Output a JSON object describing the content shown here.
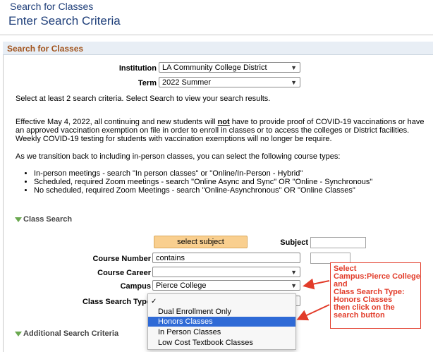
{
  "header": {
    "breadcrumb": "Search for Classes",
    "title": "Enter Search Criteria"
  },
  "panel": {
    "title": "Search for Classes"
  },
  "form": {
    "institution_label": "Institution",
    "institution_value": "LA Community College District",
    "term_label": "Term",
    "term_value": "2022 Summer"
  },
  "instructions": "Select at least 2 search criteria. Select Search to view your search results.",
  "covid_notice": {
    "before": "Effective May 4, 2022, all continuing and new students will ",
    "emphasis": "not",
    "after": " have to provide proof of COVID-19 vaccinations or have an approved vaccination exemption on file in order to enroll in classes or to access the colleges or District facilities. Weekly COVID-19 testing for students with vaccination exemptions will no longer be require."
  },
  "transition_text": "As we transition back to including in-person classes, you can select the following course types:",
  "course_types": [
    "In-person meetings - search \"In person classes\" or \"Online/In-Person - Hybrid\"",
    "Scheduled, required Zoom meetings - search \"Online Async and Sync\" OR \"Online - Synchronous\"",
    "No scheduled, required Zoom Meetings - search \"Online-Asynchronous\" OR \"Online Classes\""
  ],
  "class_search": {
    "section_label": "Class Search",
    "select_subject_button": "select subject",
    "subject_label": "Subject",
    "subject_value": "",
    "course_number_label": "Course Number",
    "course_number_operator": "contains",
    "course_number_value": "",
    "course_career_label": "Course Career",
    "course_career_value": "",
    "campus_label": "Campus",
    "campus_value": "Pierce College",
    "class_search_type_label": "Class Search Type",
    "class_search_type_options": [
      {
        "label": "",
        "checked": true
      },
      {
        "label": "Dual Enrollment Only"
      },
      {
        "label": "Honors Classes",
        "highlighted": true
      },
      {
        "label": "In Person Classes"
      },
      {
        "label": "Low Cost Textbook Classes"
      }
    ]
  },
  "additional_search": {
    "section_label": "Additional Search Criteria"
  },
  "annotation": {
    "lines": [
      "Select",
      "Campus:Pierce College",
      "and",
      "Class Search Type:",
      "Honors Classes",
      "then click on the",
      "search button"
    ],
    "color": "#e23c2a"
  },
  "colors": {
    "title_blue": "#1f3f7a",
    "section_orange": "#a0521b",
    "button_orange": "#f9cf8f",
    "highlight_blue": "#2f6ad6"
  }
}
